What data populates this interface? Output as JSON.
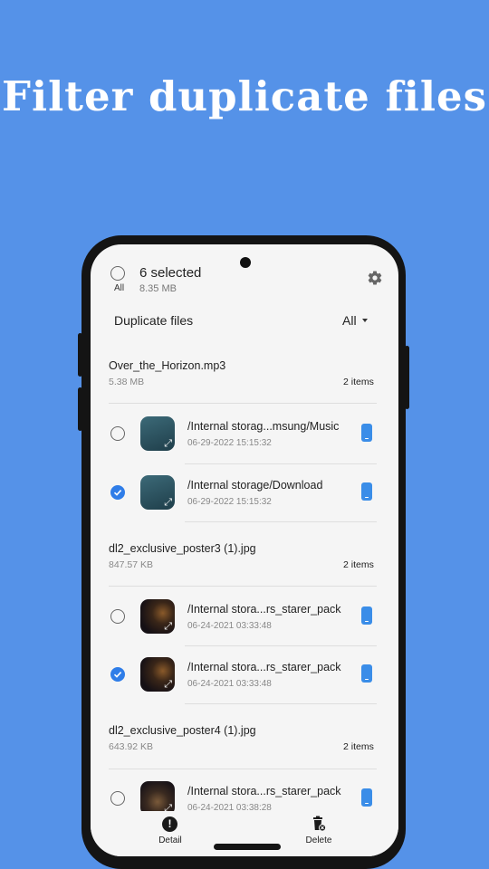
{
  "headline": "Filter duplicate files",
  "header": {
    "select_all_label": "All",
    "selected_count": "6 selected",
    "selected_size": "8.35 MB"
  },
  "list_header": {
    "title": "Duplicate files",
    "filter_value": "All"
  },
  "groups": [
    {
      "name": "Over_the_Horizon.mp3",
      "size": "5.38 MB",
      "count": "2 items",
      "files": [
        {
          "path": "/Internal storag...msung/Music",
          "date": "06-29-2022 15:15:32",
          "checked": false
        },
        {
          "path": "/Internal storage/Download",
          "date": "06-29-2022 15:15:32",
          "checked": true
        }
      ]
    },
    {
      "name": "dl2_exclusive_poster3 (1).jpg",
      "size": "847.57 KB",
      "count": "2 items",
      "files": [
        {
          "path": "/Internal stora...rs_starer_pack",
          "date": "06-24-2021 03:33:48",
          "checked": false
        },
        {
          "path": "/Internal stora...rs_starer_pack",
          "date": "06-24-2021 03:33:48",
          "checked": true
        }
      ]
    },
    {
      "name": "dl2_exclusive_poster4 (1).jpg",
      "size": "643.92 KB",
      "count": "2 items",
      "files": [
        {
          "path": "/Internal stora...rs_starer_pack",
          "date": "06-24-2021 03:38:28",
          "checked": false
        }
      ]
    }
  ],
  "bottom_bar": {
    "detail_label": "Detail",
    "delete_label": "Delete"
  },
  "colors": {
    "background": "#5592e8",
    "accent": "#2f7de8",
    "device_icon": "#3a8de8"
  }
}
